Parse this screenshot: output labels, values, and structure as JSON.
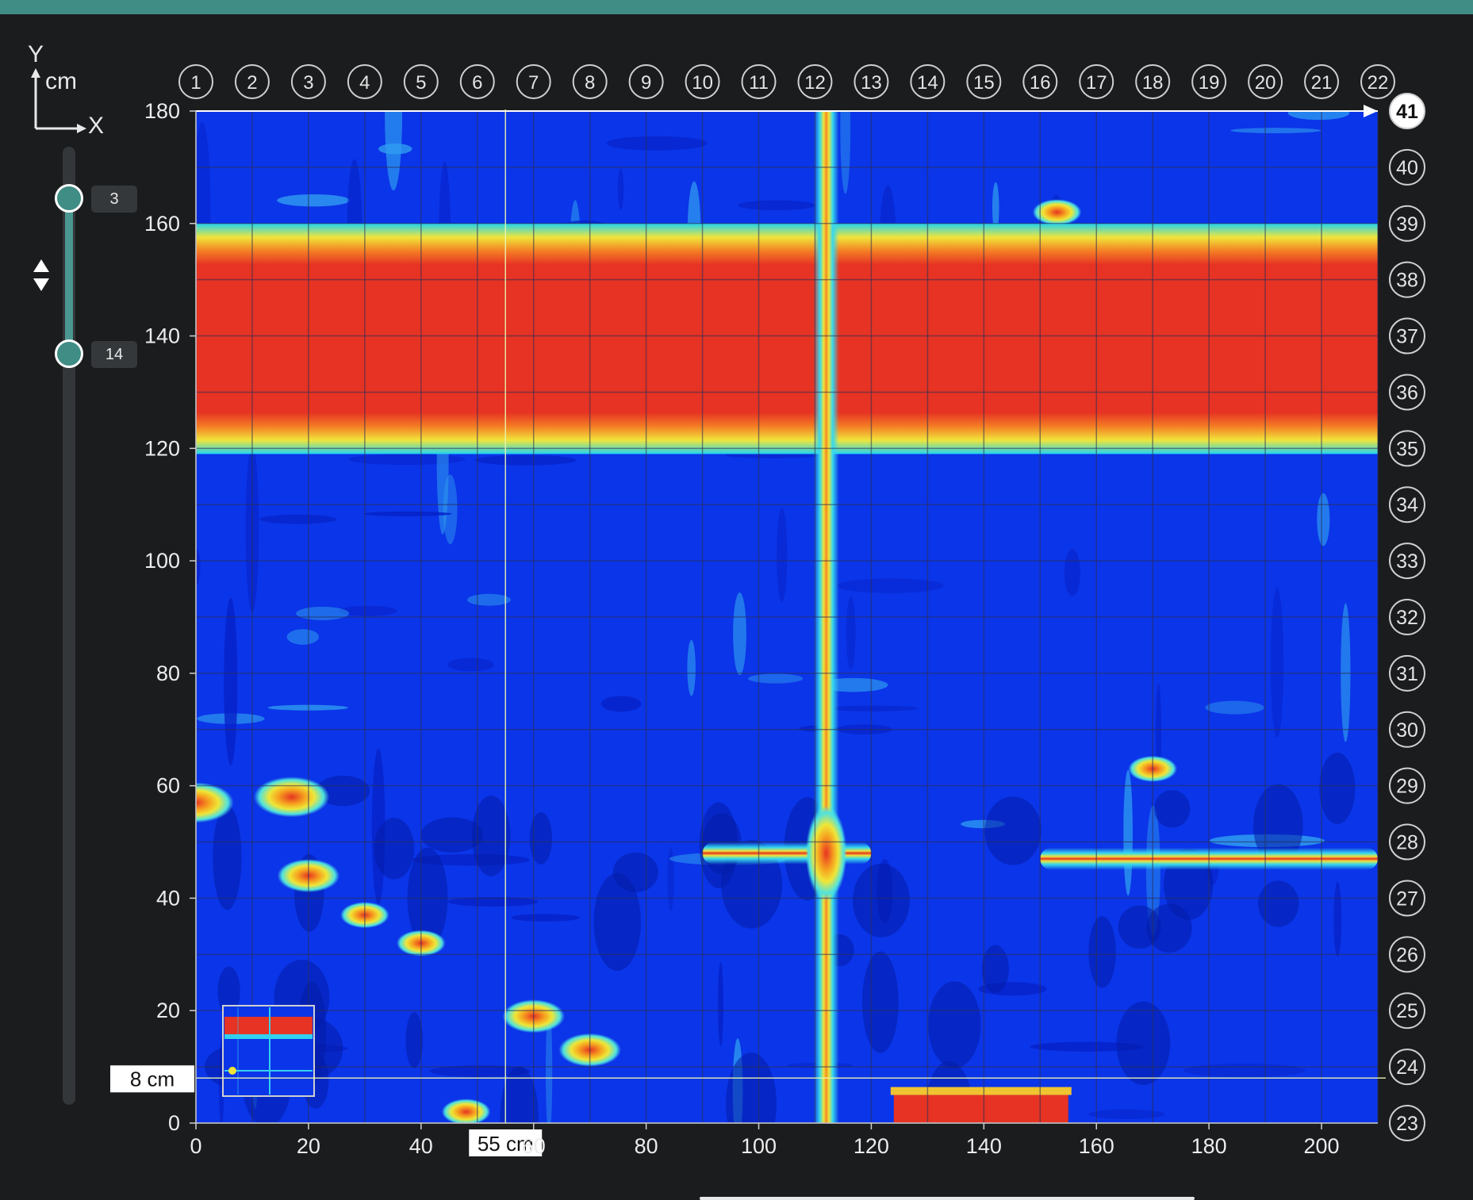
{
  "axis_legend": {
    "y": "Y",
    "x": "X",
    "unit": "cm"
  },
  "slider": {
    "top_value": "3",
    "bottom_value": "14",
    "top_fraction": 0.055,
    "bottom_fraction": 0.19
  },
  "cursor": {
    "x_value": 55,
    "y_value": 8,
    "x_label": "55 cm",
    "y_label": "8 cm"
  },
  "colors": {
    "accent": "#3f8d85",
    "background": "#1b1c1e",
    "cold": "#0a2ee6",
    "hot": "#e63323"
  },
  "chart_data": {
    "type": "heatmap",
    "xlim": [
      0,
      210
    ],
    "ylim": [
      0,
      180
    ],
    "x_ticks": [
      "0",
      "20",
      "40",
      "60",
      "80",
      "100",
      "120",
      "140",
      "160",
      "180",
      "200"
    ],
    "y_ticks": [
      "0",
      "20",
      "40",
      "60",
      "80",
      "100",
      "120",
      "140",
      "160",
      "180"
    ],
    "column_lines": [
      "1",
      "2",
      "3",
      "4",
      "5",
      "6",
      "7",
      "8",
      "9",
      "10",
      "11",
      "12",
      "13",
      "14",
      "15",
      "16",
      "17",
      "18",
      "19",
      "20",
      "21",
      "22"
    ],
    "column_line_x": [
      0,
      10,
      20,
      30,
      40,
      50,
      60,
      70,
      80,
      90,
      100,
      110,
      120,
      130,
      140,
      150,
      160,
      170,
      180,
      190,
      200,
      210
    ],
    "row_lines": [
      "23",
      "24",
      "25",
      "26",
      "27",
      "28",
      "29",
      "30",
      "31",
      "32",
      "33",
      "34",
      "35",
      "36",
      "37",
      "38",
      "39",
      "40",
      "41"
    ],
    "row_line_y": [
      0,
      10,
      20,
      30,
      40,
      50,
      60,
      70,
      80,
      90,
      100,
      110,
      120,
      130,
      140,
      150,
      160,
      170,
      180
    ],
    "selected_row_line": "41",
    "features": [
      {
        "shape": "band",
        "x": [
          0,
          210
        ],
        "y": [
          123,
          156
        ],
        "intensity": "high"
      },
      {
        "shape": "vline",
        "x": 112,
        "y": [
          0,
          180
        ],
        "intensity": "medium-high"
      },
      {
        "shape": "hline",
        "x": [
          90,
          120
        ],
        "y": 48,
        "intensity": "medium-high"
      },
      {
        "shape": "hline",
        "x": [
          150,
          210
        ],
        "y": 47,
        "intensity": "high"
      },
      {
        "shape": "block",
        "x": [
          124,
          155
        ],
        "y": [
          0,
          3
        ],
        "intensity": "high"
      },
      {
        "shape": "spot",
        "x": 0,
        "y": 57,
        "intensity": "high"
      },
      {
        "shape": "spot",
        "x": 17,
        "y": 58,
        "intensity": "high"
      },
      {
        "shape": "spot",
        "x": 20,
        "y": 44,
        "intensity": "medium-high"
      },
      {
        "shape": "spot",
        "x": 30,
        "y": 37,
        "intensity": "medium"
      },
      {
        "shape": "spot",
        "x": 40,
        "y": 32,
        "intensity": "medium"
      },
      {
        "shape": "spot",
        "x": 60,
        "y": 19,
        "intensity": "medium-high"
      },
      {
        "shape": "spot",
        "x": 70,
        "y": 13,
        "intensity": "medium-high"
      },
      {
        "shape": "spot",
        "x": 48,
        "y": 2,
        "intensity": "medium"
      },
      {
        "shape": "spot",
        "x": 153,
        "y": 162,
        "intensity": "medium"
      },
      {
        "shape": "spot",
        "x": 170,
        "y": 63,
        "intensity": "medium"
      }
    ]
  }
}
